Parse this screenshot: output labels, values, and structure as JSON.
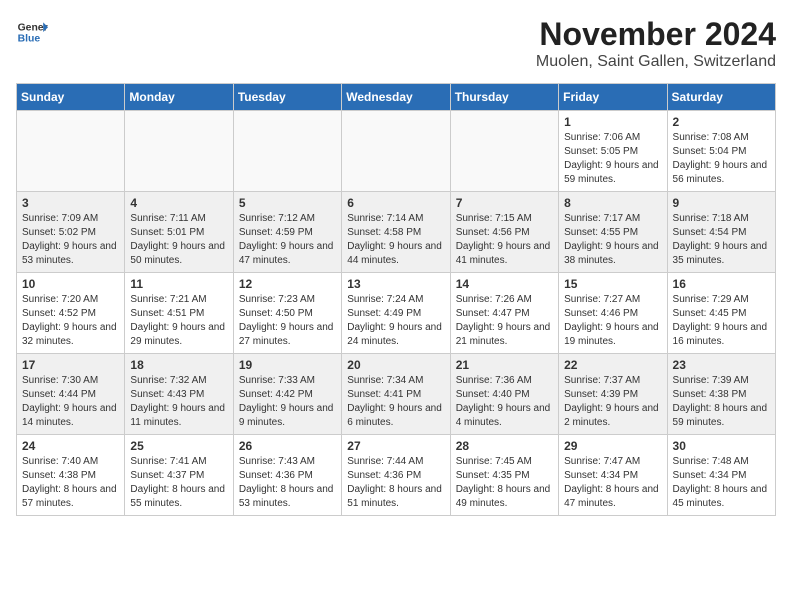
{
  "header": {
    "logo_line1": "General",
    "logo_line2": "Blue",
    "month": "November 2024",
    "location": "Muolen, Saint Gallen, Switzerland"
  },
  "weekdays": [
    "Sunday",
    "Monday",
    "Tuesday",
    "Wednesday",
    "Thursday",
    "Friday",
    "Saturday"
  ],
  "weeks": [
    {
      "shaded": false,
      "days": [
        {
          "num": "",
          "info": ""
        },
        {
          "num": "",
          "info": ""
        },
        {
          "num": "",
          "info": ""
        },
        {
          "num": "",
          "info": ""
        },
        {
          "num": "",
          "info": ""
        },
        {
          "num": "1",
          "info": "Sunrise: 7:06 AM\nSunset: 5:05 PM\nDaylight: 9 hours and 59 minutes."
        },
        {
          "num": "2",
          "info": "Sunrise: 7:08 AM\nSunset: 5:04 PM\nDaylight: 9 hours and 56 minutes."
        }
      ]
    },
    {
      "shaded": true,
      "days": [
        {
          "num": "3",
          "info": "Sunrise: 7:09 AM\nSunset: 5:02 PM\nDaylight: 9 hours and 53 minutes."
        },
        {
          "num": "4",
          "info": "Sunrise: 7:11 AM\nSunset: 5:01 PM\nDaylight: 9 hours and 50 minutes."
        },
        {
          "num": "5",
          "info": "Sunrise: 7:12 AM\nSunset: 4:59 PM\nDaylight: 9 hours and 47 minutes."
        },
        {
          "num": "6",
          "info": "Sunrise: 7:14 AM\nSunset: 4:58 PM\nDaylight: 9 hours and 44 minutes."
        },
        {
          "num": "7",
          "info": "Sunrise: 7:15 AM\nSunset: 4:56 PM\nDaylight: 9 hours and 41 minutes."
        },
        {
          "num": "8",
          "info": "Sunrise: 7:17 AM\nSunset: 4:55 PM\nDaylight: 9 hours and 38 minutes."
        },
        {
          "num": "9",
          "info": "Sunrise: 7:18 AM\nSunset: 4:54 PM\nDaylight: 9 hours and 35 minutes."
        }
      ]
    },
    {
      "shaded": false,
      "days": [
        {
          "num": "10",
          "info": "Sunrise: 7:20 AM\nSunset: 4:52 PM\nDaylight: 9 hours and 32 minutes."
        },
        {
          "num": "11",
          "info": "Sunrise: 7:21 AM\nSunset: 4:51 PM\nDaylight: 9 hours and 29 minutes."
        },
        {
          "num": "12",
          "info": "Sunrise: 7:23 AM\nSunset: 4:50 PM\nDaylight: 9 hours and 27 minutes."
        },
        {
          "num": "13",
          "info": "Sunrise: 7:24 AM\nSunset: 4:49 PM\nDaylight: 9 hours and 24 minutes."
        },
        {
          "num": "14",
          "info": "Sunrise: 7:26 AM\nSunset: 4:47 PM\nDaylight: 9 hours and 21 minutes."
        },
        {
          "num": "15",
          "info": "Sunrise: 7:27 AM\nSunset: 4:46 PM\nDaylight: 9 hours and 19 minutes."
        },
        {
          "num": "16",
          "info": "Sunrise: 7:29 AM\nSunset: 4:45 PM\nDaylight: 9 hours and 16 minutes."
        }
      ]
    },
    {
      "shaded": true,
      "days": [
        {
          "num": "17",
          "info": "Sunrise: 7:30 AM\nSunset: 4:44 PM\nDaylight: 9 hours and 14 minutes."
        },
        {
          "num": "18",
          "info": "Sunrise: 7:32 AM\nSunset: 4:43 PM\nDaylight: 9 hours and 11 minutes."
        },
        {
          "num": "19",
          "info": "Sunrise: 7:33 AM\nSunset: 4:42 PM\nDaylight: 9 hours and 9 minutes."
        },
        {
          "num": "20",
          "info": "Sunrise: 7:34 AM\nSunset: 4:41 PM\nDaylight: 9 hours and 6 minutes."
        },
        {
          "num": "21",
          "info": "Sunrise: 7:36 AM\nSunset: 4:40 PM\nDaylight: 9 hours and 4 minutes."
        },
        {
          "num": "22",
          "info": "Sunrise: 7:37 AM\nSunset: 4:39 PM\nDaylight: 9 hours and 2 minutes."
        },
        {
          "num": "23",
          "info": "Sunrise: 7:39 AM\nSunset: 4:38 PM\nDaylight: 8 hours and 59 minutes."
        }
      ]
    },
    {
      "shaded": false,
      "days": [
        {
          "num": "24",
          "info": "Sunrise: 7:40 AM\nSunset: 4:38 PM\nDaylight: 8 hours and 57 minutes."
        },
        {
          "num": "25",
          "info": "Sunrise: 7:41 AM\nSunset: 4:37 PM\nDaylight: 8 hours and 55 minutes."
        },
        {
          "num": "26",
          "info": "Sunrise: 7:43 AM\nSunset: 4:36 PM\nDaylight: 8 hours and 53 minutes."
        },
        {
          "num": "27",
          "info": "Sunrise: 7:44 AM\nSunset: 4:36 PM\nDaylight: 8 hours and 51 minutes."
        },
        {
          "num": "28",
          "info": "Sunrise: 7:45 AM\nSunset: 4:35 PM\nDaylight: 8 hours and 49 minutes."
        },
        {
          "num": "29",
          "info": "Sunrise: 7:47 AM\nSunset: 4:34 PM\nDaylight: 8 hours and 47 minutes."
        },
        {
          "num": "30",
          "info": "Sunrise: 7:48 AM\nSunset: 4:34 PM\nDaylight: 8 hours and 45 minutes."
        }
      ]
    }
  ]
}
